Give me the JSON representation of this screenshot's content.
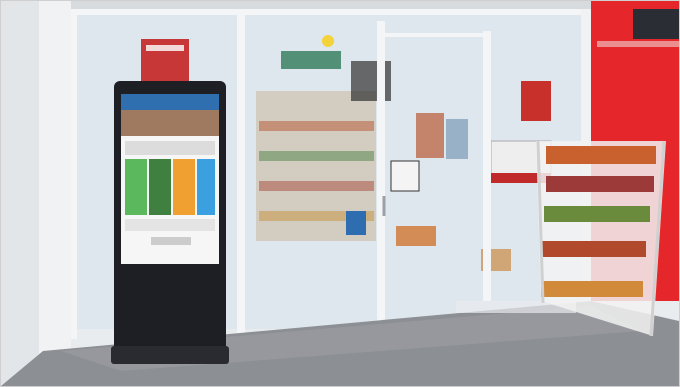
{
  "image": {
    "subject": "",
    "brand": "",
    "colors": {
      "kiosk_frame": "#1e1f24",
      "screen_header": "#2f6fb0",
      "tile_green": "#5cb85c",
      "tile_orange": "#f0a030",
      "tile_blue": "#3aa0e0",
      "red_panel": "#e5262a",
      "floor": "#8c8f93",
      "glass": "#dfe7ee"
    }
  }
}
